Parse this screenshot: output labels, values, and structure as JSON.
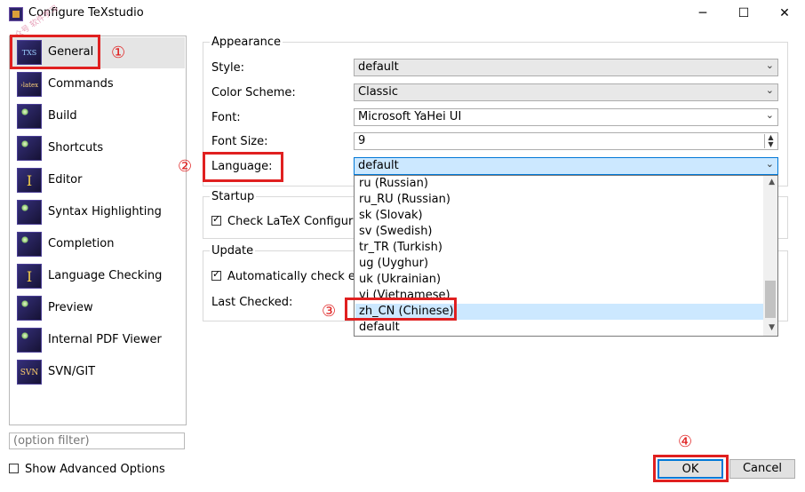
{
  "window": {
    "title": "Configure TeXstudio",
    "controls": [
      "─",
      "☐",
      "✕"
    ]
  },
  "watermark": "公众号 软件学习",
  "sidebar": {
    "items": [
      {
        "label": "General",
        "icon": "TXS"
      },
      {
        "label": "Commands",
        "icon": "›latex"
      },
      {
        "label": "Build",
        "icon": ""
      },
      {
        "label": "Shortcuts",
        "icon": ""
      },
      {
        "label": "Editor",
        "icon": "I"
      },
      {
        "label": "Syntax Highlighting",
        "icon": ""
      },
      {
        "label": "Completion",
        "icon": ""
      },
      {
        "label": "Language Checking",
        "icon": "I"
      },
      {
        "label": "Preview",
        "icon": ""
      },
      {
        "label": "Internal PDF Viewer",
        "icon": ""
      },
      {
        "label": "SVN/GIT",
        "icon": "SVN"
      }
    ],
    "filter_placeholder": "(option filter)",
    "advanced_label": "Show Advanced Options"
  },
  "appearance": {
    "title": "Appearance",
    "style_label": "Style:",
    "style_value": "default",
    "color_label": "Color Scheme:",
    "color_value": "Classic",
    "font_label": "Font:",
    "font_value": "Microsoft YaHei UI",
    "fontsize_label": "Font Size:",
    "fontsize_value": "9",
    "language_label": "Language:",
    "language_value": "default"
  },
  "startup": {
    "title": "Startup",
    "check_label": "Check LaTeX Configuratio"
  },
  "update": {
    "title": "Update",
    "check_label": "Automatically check ever",
    "last_checked_label": "Last Checked:"
  },
  "language_dropdown": {
    "options": [
      "ru  (Russian)",
      "ru_RU  (Russian)",
      "sk  (Slovak)",
      "sv  (Swedish)",
      "tr_TR  (Turkish)",
      "ug  (Uyghur)",
      "uk  (Ukrainian)",
      "vi  (Vietnamese)",
      "zh_CN  (Chinese)",
      "default"
    ],
    "highlighted": "zh_CN  (Chinese)"
  },
  "annotations": {
    "m1": "①",
    "m2": "②",
    "m3": "③",
    "m4": "④",
    "color": "#e02020"
  },
  "buttons": {
    "ok": "OK",
    "cancel": "Cancel"
  },
  "colors": {
    "selection": "#cce8ff",
    "accent": "#0078d7",
    "annotation": "#e02020"
  }
}
